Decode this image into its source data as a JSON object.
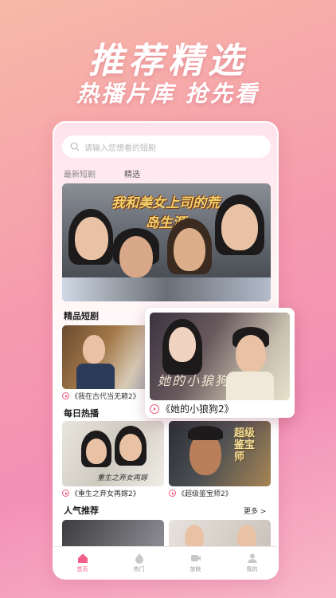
{
  "hero": {
    "title": "推荐精选",
    "subtitle": "热播片库 抢先看"
  },
  "search": {
    "placeholder": "请输入您想看的短剧"
  },
  "tabs": [
    {
      "label": "最新短剧"
    },
    {
      "label": "精选"
    }
  ],
  "banner": {
    "title": "我和美女上司的荒岛生涯"
  },
  "sections": {
    "featured": {
      "title": "精品短剧",
      "items": [
        {
          "caption": "《我在古代当无赖2》"
        }
      ]
    },
    "daily": {
      "title": "每日热播",
      "items": [
        {
          "caption": "《重生之弃女再嫁2》"
        },
        {
          "caption": "《超级鉴宝师2》"
        }
      ]
    },
    "popular": {
      "title": "人气推荐",
      "more": "更多 >"
    }
  },
  "popout": {
    "caption": "《她的小狼狗2》"
  },
  "poster_text": {
    "daily_2": "超级鉴宝师",
    "daily_1": "重生之弃女再嫁",
    "popout": "她的小狼狗"
  },
  "nav": [
    {
      "label": "首页",
      "icon": "home-icon",
      "active": true
    },
    {
      "label": "热门",
      "icon": "fire-icon",
      "active": false
    },
    {
      "label": "放映",
      "icon": "video-icon",
      "active": false
    },
    {
      "label": "我的",
      "icon": "user-icon",
      "active": false
    }
  ],
  "colors": {
    "accent": "#f0608a"
  }
}
